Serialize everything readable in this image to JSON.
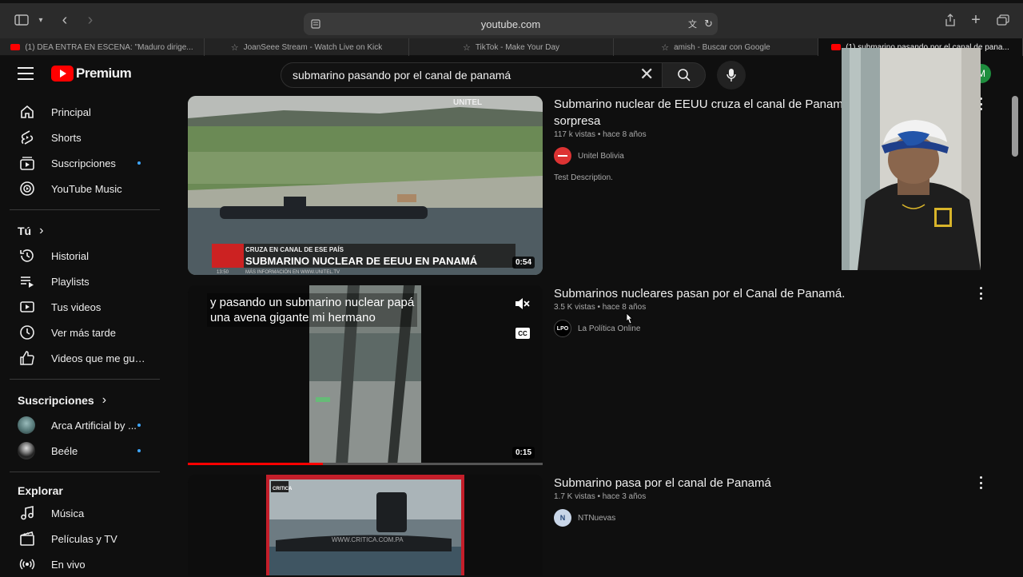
{
  "browser": {
    "url": "youtube.com",
    "tabs": [
      {
        "label": "(1) DEA ENTRA EN ESCENA: \"Maduro dirige...",
        "icon": "youtube-icon",
        "active": false
      },
      {
        "label": "JoanSeee Stream - Watch Live on Kick",
        "icon": "star-icon",
        "active": false
      },
      {
        "label": "TikTok - Make Your Day",
        "icon": "star-icon",
        "active": false
      },
      {
        "label": "amish - Buscar con Google",
        "icon": "star-icon",
        "active": false
      },
      {
        "label": "(1) submarino pasando por el canal de pana...",
        "icon": "youtube-icon",
        "active": true
      }
    ]
  },
  "header": {
    "logo_text": "Premium",
    "search_value": "submarino pasando por el canal de panamá",
    "avatar_letter": "M"
  },
  "sidebar": {
    "main": [
      {
        "label": "Principal",
        "icon": "home-icon"
      },
      {
        "label": "Shorts",
        "icon": "shorts-icon"
      },
      {
        "label": "Suscripciones",
        "icon": "subscriptions-icon",
        "dot": true
      },
      {
        "label": "YouTube Music",
        "icon": "music-circle-icon"
      }
    ],
    "you_heading": "Tú",
    "you": [
      {
        "label": "Historial",
        "icon": "history-icon"
      },
      {
        "label": "Playlists",
        "icon": "playlists-icon"
      },
      {
        "label": "Tus videos",
        "icon": "your-videos-icon"
      },
      {
        "label": "Ver más tarde",
        "icon": "clock-icon"
      },
      {
        "label": "Videos que me gus...",
        "icon": "thumbs-up-icon"
      }
    ],
    "subs_heading": "Suscripciones",
    "subs": [
      {
        "label": "Arca Artificial by ...",
        "dot": true
      },
      {
        "label": "Beéle",
        "dot": true
      }
    ],
    "explore_heading": "Explorar",
    "explore": [
      {
        "label": "Música",
        "icon": "music-note-icon"
      },
      {
        "label": "Películas y TV",
        "icon": "film-icon"
      },
      {
        "label": "En vivo",
        "icon": "live-icon"
      }
    ]
  },
  "results": [
    {
      "title_line1": "Submarino nuclear de EEUU cruza el canal de Panamá",
      "title_line2": "sorpresa",
      "meta": "117 k vistas • hace 8 años",
      "channel": "Unitel Bolivia",
      "description": "Test Description.",
      "duration": "0:54",
      "thumb_caption_top": "CRUZA EN CANAL DE ESE PAÍS",
      "thumb_caption": "SUBMARINO NUCLEAR DE EEUU EN PANAMÁ",
      "thumb_caption_sub": "MÁS INFORMACIÓN EN WWW.UNITEL.TV",
      "thumb_brand": "UNITEL",
      "thumb_time": "13:50"
    },
    {
      "title_line1": "Submarinos nucleares pasan por el Canal de Panamá.",
      "meta": "3.5 K vistas • hace 8 años",
      "channel": "La Política Online",
      "channel_abbr": "LPO",
      "duration": "0:15",
      "subtitle_line1": "y pasando un submarino nuclear papá",
      "subtitle_line2": "una avena gigante mi hermano",
      "cc_label": "CC",
      "progress": 0.38
    },
    {
      "title_line1": "Submarino pasa por el canal de Panamá",
      "meta": "1.7 K vistas • hace 3 años",
      "channel": "NTNuevas",
      "channel_abbr": "N",
      "thumb_brand": "CRITICA",
      "thumb_watermark": "WWW.CRITICA.COM.PA"
    }
  ]
}
